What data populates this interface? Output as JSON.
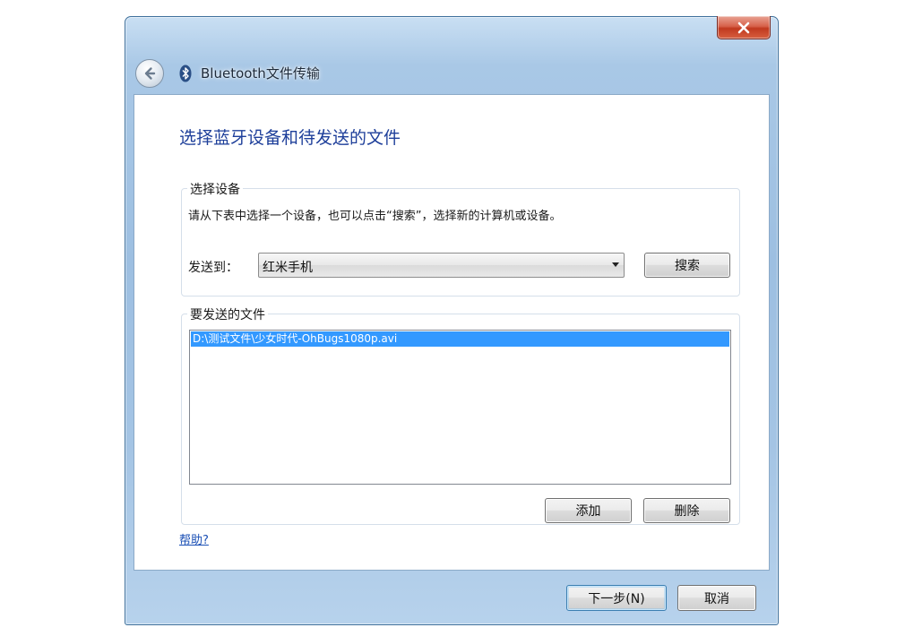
{
  "window": {
    "title": "Bluetooth文件传输",
    "close_label": "✕"
  },
  "icons": {
    "back": "back-arrow-icon",
    "bluetooth": "bluetooth-icon",
    "close": "close-icon",
    "dropdown": "chevron-down-icon"
  },
  "main": {
    "heading": "选择蓝牙设备和待发送的文件",
    "device_group": {
      "legend": "选择设备",
      "instructions": "请从下表中选择一个设备，也可以点击“搜索”，选择新的计算机或设备。",
      "send_to_label": "发送到：",
      "selected_device": "红米手机",
      "search_button": "搜索"
    },
    "files_group": {
      "legend": "要发送的文件",
      "files": [
        "D:\\测试文件\\少女时代-OhBugs1080p.avi"
      ],
      "add_button": "添加",
      "delete_button": "删除"
    },
    "help_link": "帮助?"
  },
  "footer": {
    "next_button": "下一步(N)",
    "cancel_button": "取消"
  },
  "colors": {
    "heading": "#1e3f9a",
    "selection": "#3399ff",
    "link": "#1a4fb5",
    "close_button": "#c1391f"
  }
}
